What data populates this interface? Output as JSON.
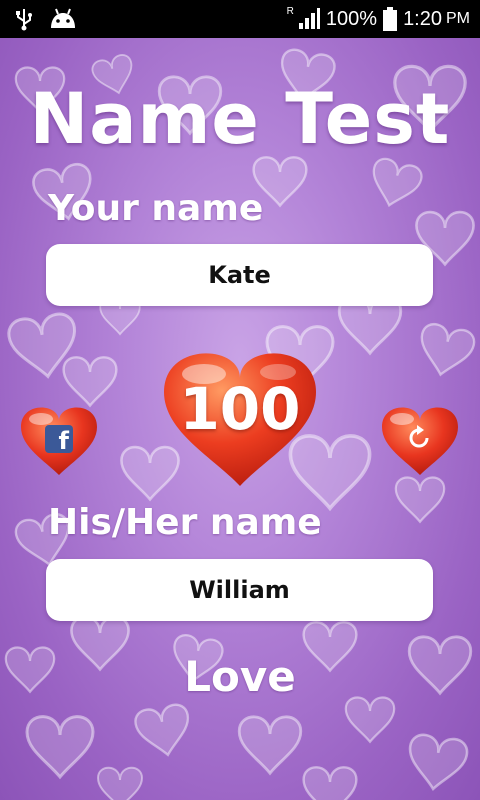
{
  "status_bar": {
    "usb_icon": "usb-icon",
    "android_icon": "android-icon",
    "roaming": "R",
    "battery_percent": "100%",
    "time": "1:20",
    "ampm": "PM"
  },
  "app": {
    "title": "Name Test",
    "your_name_label": "Your name",
    "your_name_value": "Kate",
    "partner_name_label": "His/Her name",
    "partner_name_value": "William",
    "score": "100",
    "result_label": "Love",
    "share_icon": "facebook-icon",
    "retry_icon": "refresh-icon"
  },
  "colors": {
    "background": "#b384d8",
    "heart_red": "#e8351f",
    "facebook_blue": "#3b5998"
  }
}
